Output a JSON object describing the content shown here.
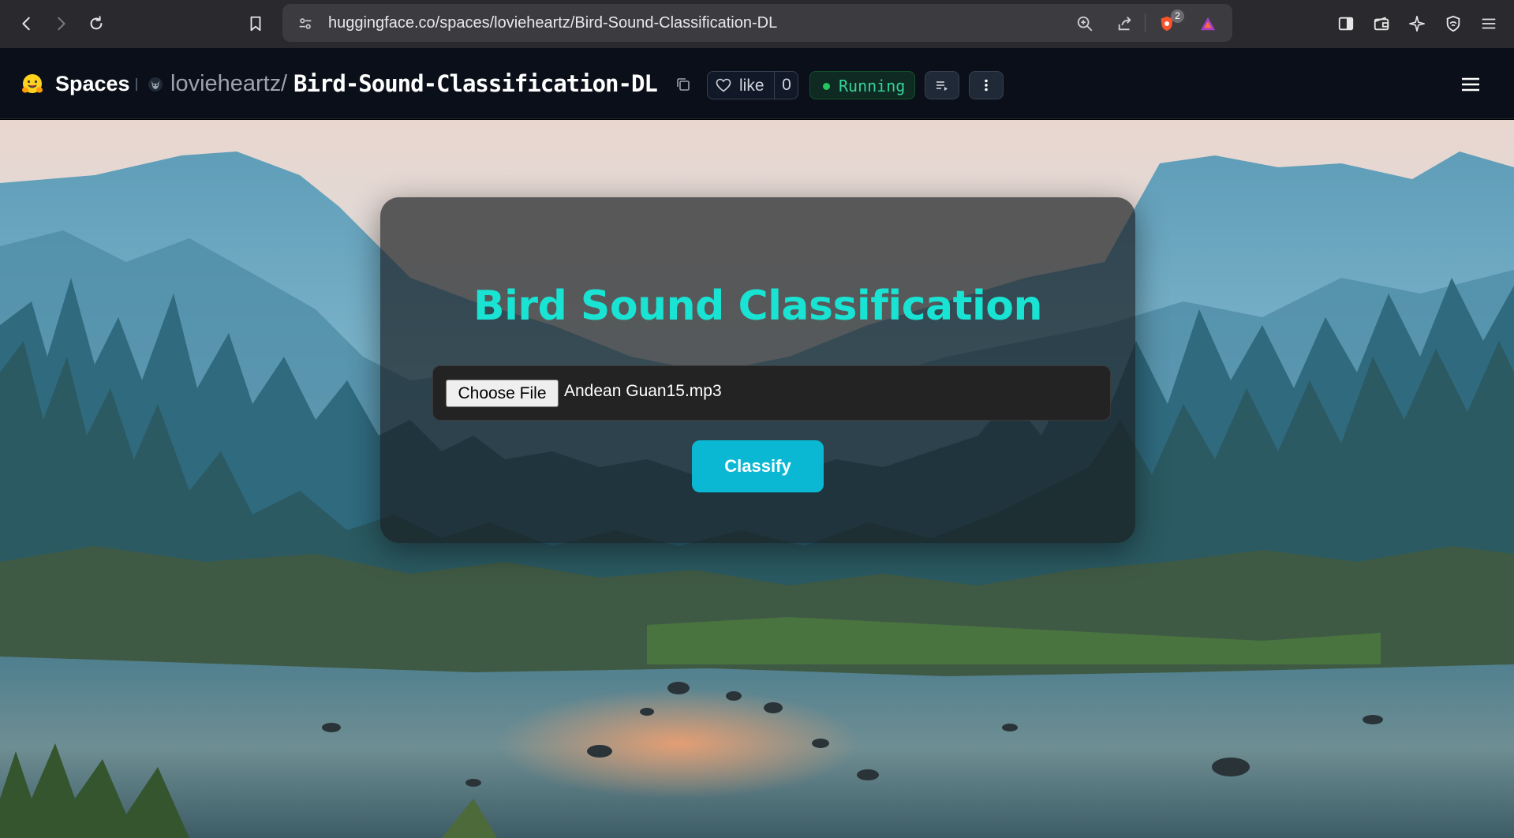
{
  "browser": {
    "url": "huggingface.co/spaces/lovieheartz/Bird-Sound-Classification-DL",
    "brave_badge_count": "2",
    "icons": [
      "back-arrow-icon",
      "forward-arrow-icon",
      "reload-icon",
      "bookmark-icon",
      "site-info-icon",
      "zoom-icon",
      "share-icon",
      "brave-shields-icon",
      "brave-rewards-icon",
      "sidebar-icon",
      "wallet-icon",
      "leo-ai-icon",
      "vpn-icon",
      "menu-icon"
    ]
  },
  "header": {
    "brand": "Spaces",
    "owner": "lovieheartz",
    "separator": "/",
    "space_name": "Bird-Sound-Classification-DL",
    "like_label": "like",
    "like_count": "0",
    "status": "Running",
    "colors": {
      "status_green": "#22c55e",
      "header_bg": "#0b0f19"
    }
  },
  "app": {
    "title": "Bird Sound Classification",
    "choose_file_label": "Choose File",
    "selected_file": "Andean Guan15.mp3",
    "classify_label": "Classify",
    "colors": {
      "title": "#19e3d2",
      "button": "#0bb8d3"
    }
  }
}
